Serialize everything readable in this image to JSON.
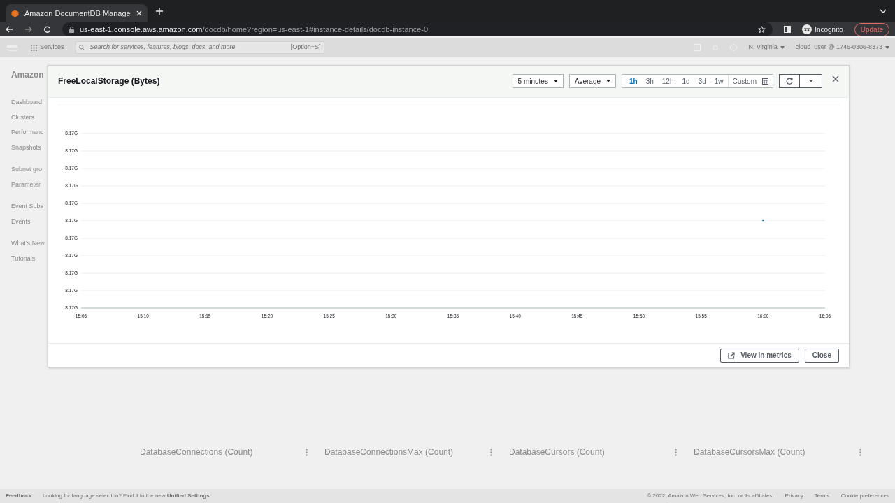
{
  "browser": {
    "tab_title": "Amazon DocumentDB Manage",
    "url_host": "us-east-1.console.aws.amazon.com",
    "url_path": "/docdb/home?region=us-east-1#instance-details/docdb-instance-0",
    "profile": "Incognito",
    "update": "Update"
  },
  "aws_nav": {
    "services": "Services",
    "search": {
      "placeholder": "Search for services, features, blogs, docs, and more"
    },
    "shortcut": "[Option+S]",
    "region": "N. Virginia",
    "account": "cloud_user @ 1746-0306-8373"
  },
  "sidebar": {
    "heading": "Amazon",
    "items": [
      "Dashboard",
      "Clusters",
      "Performanc",
      "Snapshots",
      "Subnet gro",
      "Parameter",
      "Event Subs",
      "Events",
      "What's New",
      "Tutorials"
    ]
  },
  "background_cards": [
    "DatabaseConnections (Count)",
    "DatabaseConnectionsMax (Count)",
    "DatabaseCursors (Count)",
    "DatabaseCursorsMax (Count)"
  ],
  "footer": {
    "feedback": "Feedback",
    "notice": "Looking for language selection? Find it in the new",
    "settings_link": "Unified Settings",
    "copyright": "© 2022, Amazon Web Services, Inc. or its affiliates.",
    "links": [
      "Privacy",
      "Terms",
      "Cookie preferences"
    ]
  },
  "modal": {
    "title": "FreeLocalStorage (Bytes)",
    "period": "5 minutes",
    "statistic": "Average",
    "ranges": [
      {
        "label": "1h",
        "selected": true
      },
      {
        "label": "3h",
        "selected": false
      },
      {
        "label": "12h",
        "selected": false
      },
      {
        "label": "1d",
        "selected": false
      },
      {
        "label": "3d",
        "selected": false
      },
      {
        "label": "1w",
        "selected": false
      }
    ],
    "custom": "Custom",
    "chart": {
      "y_labels": [
        "8.17G",
        "8.17G",
        "8.17G",
        "8.17G",
        "8.17G",
        "8.17G",
        "8.17G",
        "8.17G",
        "8.17G",
        "8.17G",
        "8.17G"
      ],
      "x_labels": [
        "15:05",
        "15:10",
        "15:15",
        "15:20",
        "15:25",
        "15:30",
        "15:35",
        "15:40",
        "15:45",
        "15:50",
        "15:55",
        "16:00",
        "16:05"
      ]
    },
    "buttons": [
      "View in metrics",
      "Close"
    ]
  }
}
